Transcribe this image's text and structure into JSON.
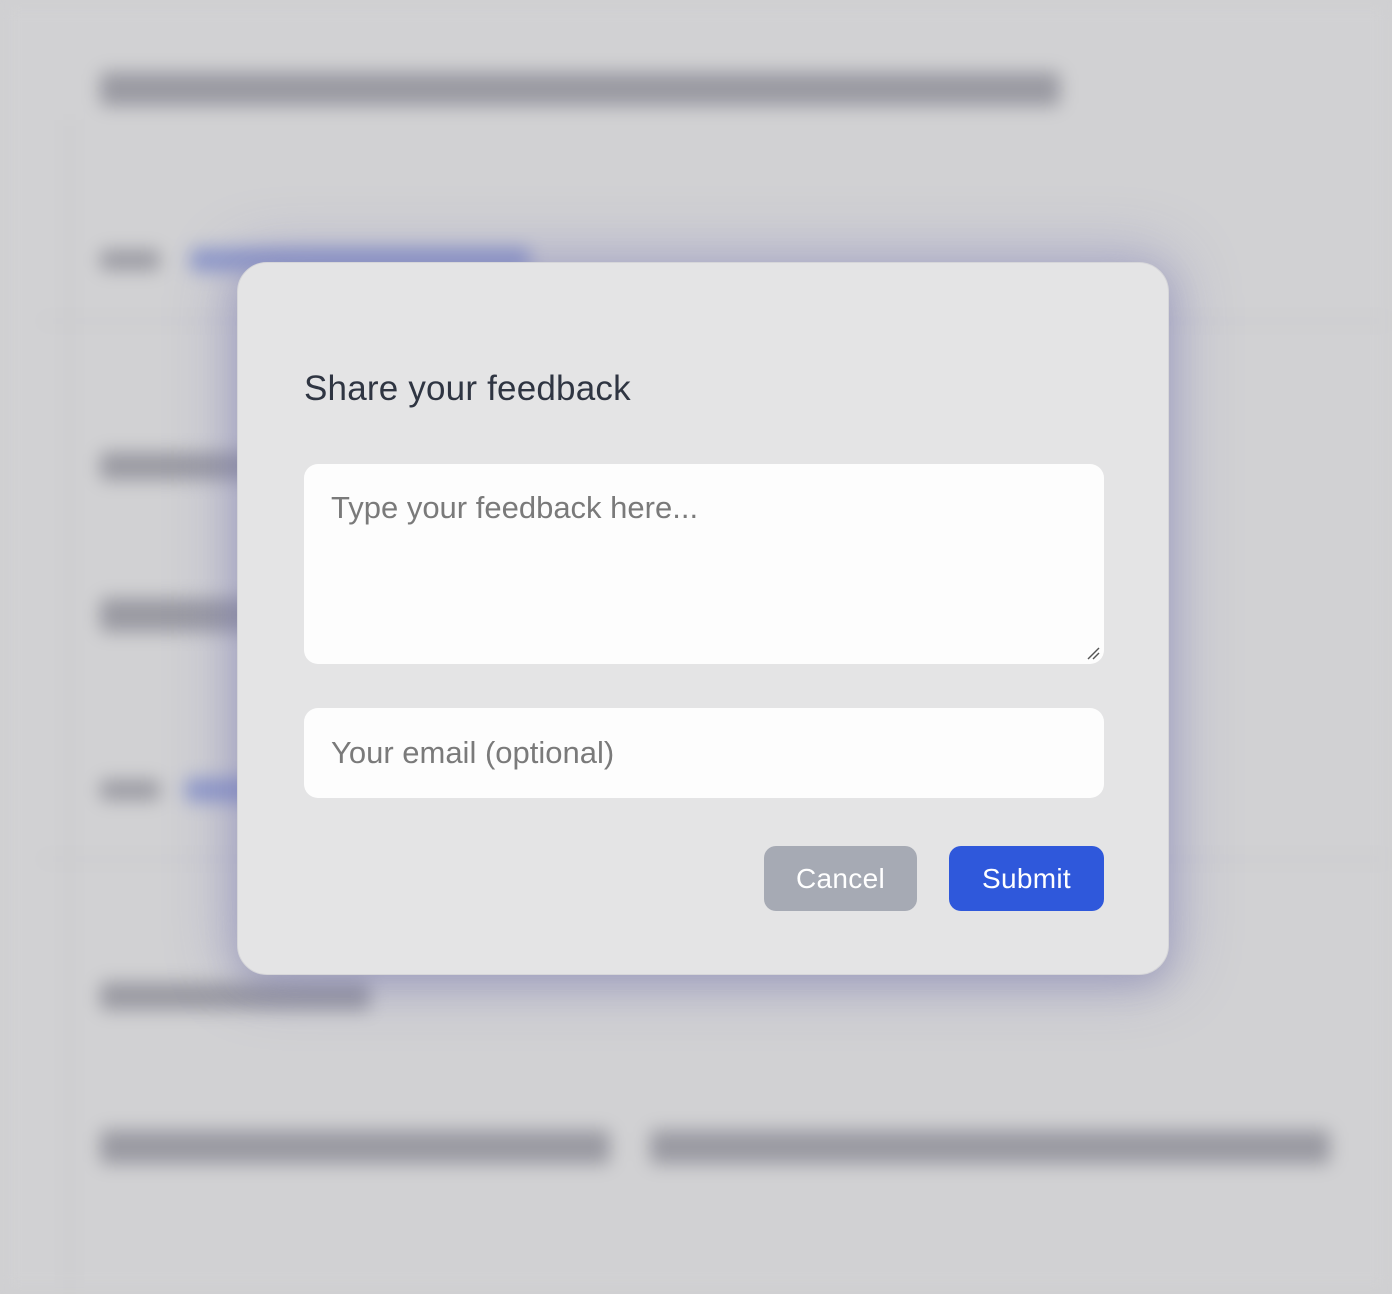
{
  "modal": {
    "title": "Share your feedback",
    "feedback_placeholder": "Type your feedback here...",
    "feedback_value": "",
    "email_placeholder": "Your email (optional)",
    "email_value": "",
    "cancel_label": "Cancel",
    "submit_label": "Submit"
  },
  "colors": {
    "submit": "#2f58db",
    "cancel": "#a6aab4",
    "modal_bg": "#e4e4e5",
    "title_text": "#2f3542",
    "backdrop": "#cfcfd1"
  },
  "icons": {
    "resize": "resize-handle-icon"
  }
}
